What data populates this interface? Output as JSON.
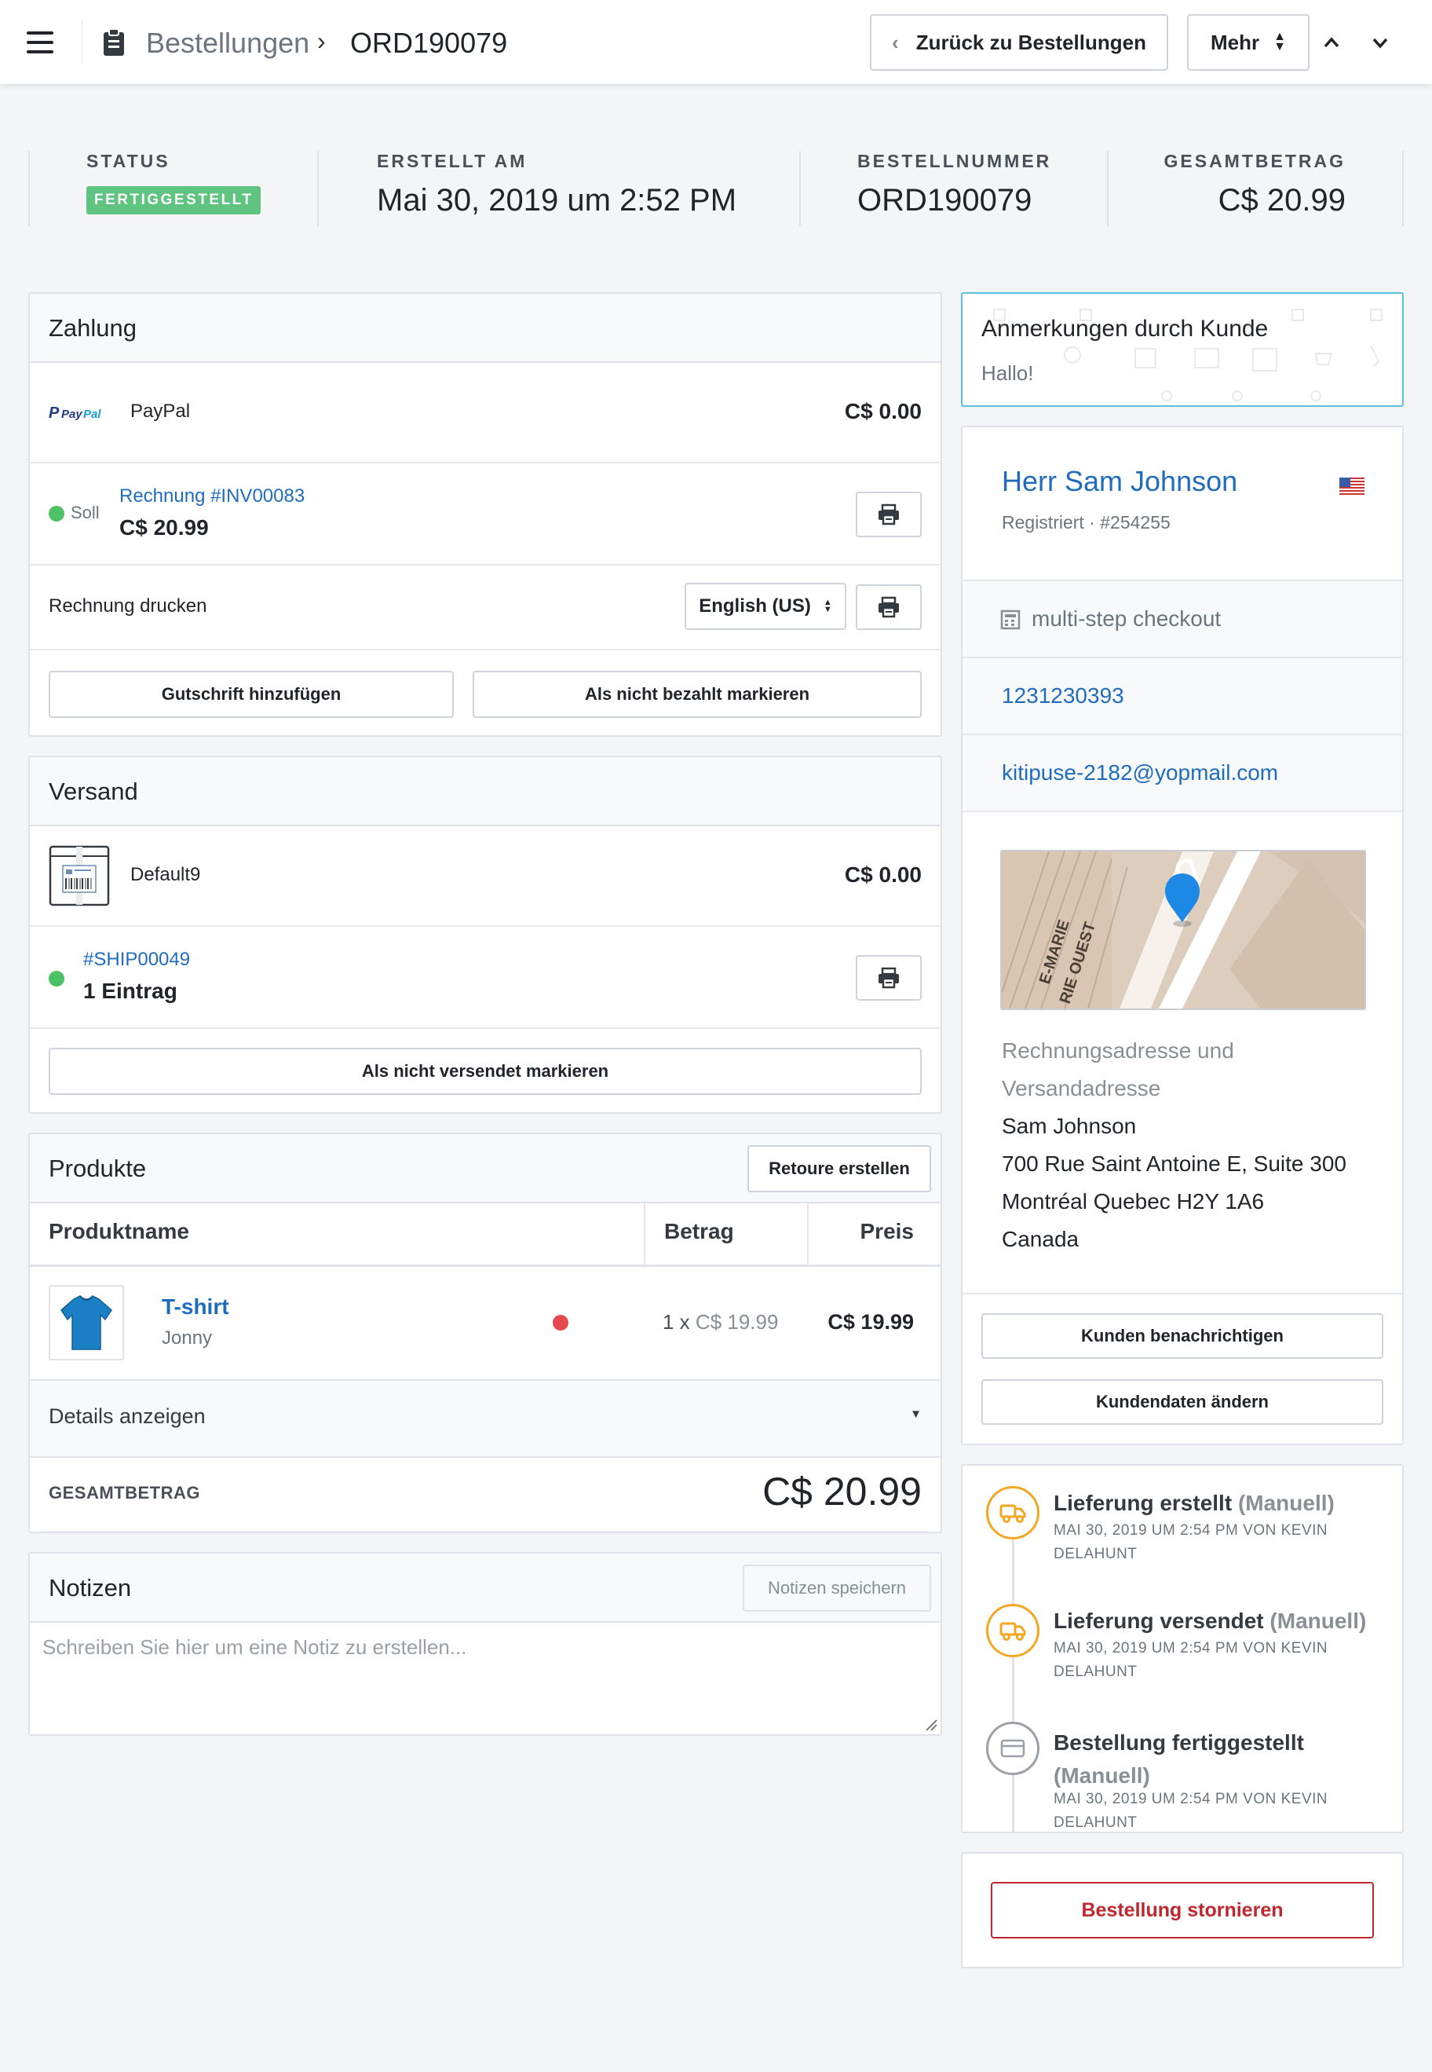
{
  "header": {
    "breadcrumb_parent": "Bestellungen",
    "breadcrumb_current": "ORD190079",
    "back_button": "Zurück zu Bestellungen",
    "more_button": "Mehr"
  },
  "summary": {
    "status_label": "STATUS",
    "status_value": "FERTIGGESTELLT",
    "created_label": "ERSTELLT AM",
    "created_value": "Mai 30, 2019 um 2:52 PM",
    "order_no_label": "BESTELLNUMMER",
    "order_no_value": "ORD190079",
    "total_label": "GESAMTBETRAG",
    "total_value": "C$ 20.99"
  },
  "payment": {
    "title": "Zahlung",
    "method_logo": "PayPal",
    "method_name": "PayPal",
    "method_amount": "C$ 0.00",
    "invoice_status": "Soll",
    "invoice_link": "Rechnung #INV00083",
    "invoice_amount": "C$ 20.99",
    "print_label": "Rechnung drucken",
    "language_select": "English (US)",
    "credit_button": "Gutschrift hinzufügen",
    "unpaid_button": "Als nicht bezahlt markieren"
  },
  "shipping": {
    "title": "Versand",
    "method_name": "Default9",
    "method_amount": "C$ 0.00",
    "shipment_link": "#SHIP00049",
    "shipment_entries": "1 Eintrag",
    "unshipped_button": "Als nicht versendet markieren"
  },
  "products": {
    "title": "Produkte",
    "return_button": "Retoure erstellen",
    "col_name": "Produktname",
    "col_amount": "Betrag",
    "col_price": "Preis",
    "items": [
      {
        "name": "T-shirt",
        "variant": "Jonny",
        "qty": "1 x",
        "unit_price": "C$ 19.99",
        "price": "C$ 19.99"
      }
    ],
    "details_toggle": "Details anzeigen",
    "total_label": "GESAMTBETRAG",
    "total_value": "C$ 20.99"
  },
  "notes": {
    "title": "Notizen",
    "save_button": "Notizen speichern",
    "placeholder": "Schreiben Sie hier um eine Notiz zu erstellen..."
  },
  "customer_note": {
    "title": "Anmerkungen durch Kunde",
    "text": "Hallo!"
  },
  "customer": {
    "name": "Herr Sam Johnson",
    "registration": "Registriert · #254255",
    "checkout": "multi-step checkout",
    "phone": "1231230393",
    "email": "kitipuse-2182@yopmail.com",
    "map_street_1": "E-MARIE",
    "map_street_2": "RIE OUEST",
    "address_label_1": "Rechnungsadresse und",
    "address_label_2": "Versandadresse",
    "address_name": "Sam Johnson",
    "address_line1": "700 Rue Saint Antoine E, Suite 300",
    "address_line2": "Montréal Quebec H2Y 1A6",
    "address_country": "Canada",
    "notify_button": "Kunden benachrichtigen",
    "edit_button": "Kundendaten ändern"
  },
  "timeline": [
    {
      "title": "Lieferung erstellt",
      "source": "(Manuell)",
      "meta": "MAI 30, 2019 UM 2:54 PM VON KEVIN DELAHUNT"
    },
    {
      "title": "Lieferung versendet",
      "source": "(Manuell)",
      "meta": "MAI 30, 2019 UM 2:54 PM VON KEVIN DELAHUNT"
    },
    {
      "title": "Bestellung fertiggestellt",
      "source": "(Manuell)",
      "meta": "MAI 30, 2019 UM 2:54 PM VON KEVIN DELAHUNT"
    }
  ],
  "cancel_button": "Bestellung stornieren",
  "colors": {
    "link": "#1f6cbf",
    "status_green": "#5fc47f",
    "danger": "#c0262d",
    "timeline_orange": "#f5a623"
  }
}
